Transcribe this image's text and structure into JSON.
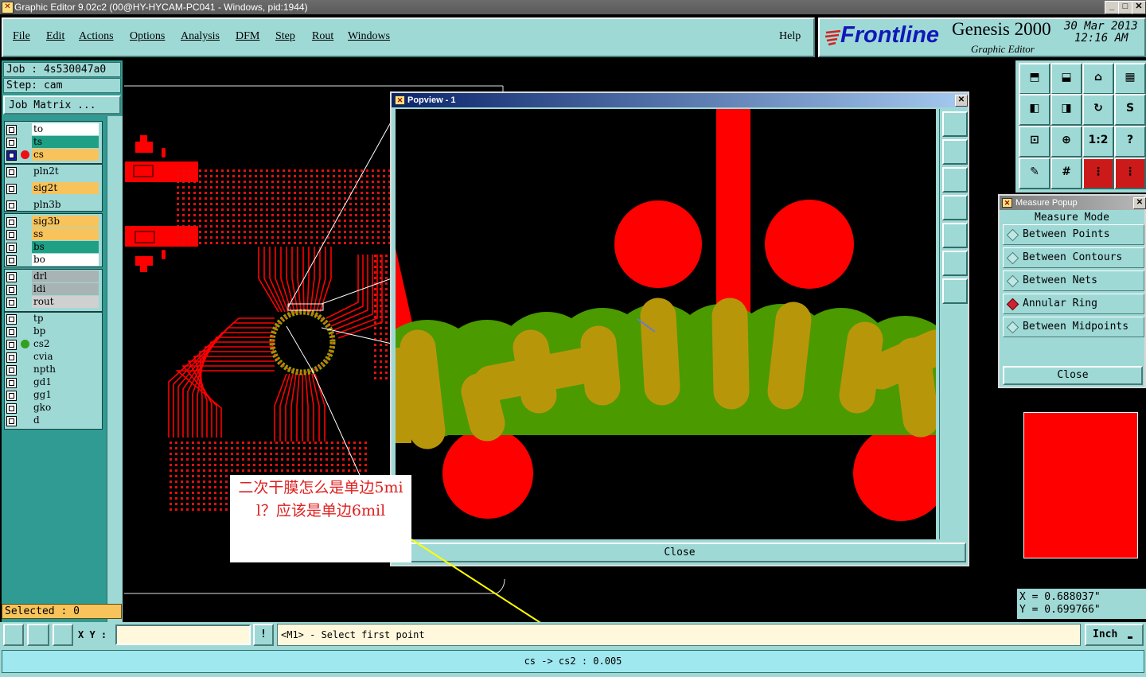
{
  "window": {
    "title": "Graphic Editor 9.02c2 (00@HY-HYCAM-PC041 - Windows, pid:1944)"
  },
  "menu": [
    "File",
    "Edit",
    "Actions",
    "Options",
    "Analysis",
    "DFM",
    "Step",
    "Rout",
    "Windows"
  ],
  "help_label": "Help",
  "brand": {
    "logo": "Frontline",
    "product": "Genesis 2000",
    "subtitle": "Graphic Editor",
    "date": "30 Mar 2013",
    "time": "12:16 AM"
  },
  "job": {
    "job": "Job : 4s530047a0",
    "step": "Step: cam",
    "matrix_button": "Job Matrix ..."
  },
  "layers": [
    {
      "name": "to",
      "color": "#ffffff"
    },
    {
      "name": "ts",
      "color": "#1f9f84"
    },
    {
      "name": "cs",
      "color": "#f8c35a"
    },
    {
      "name": "pln2t",
      "color": "#9fd9d6"
    },
    {
      "name": "sig2t",
      "color": "#f8c35a"
    },
    {
      "name": "pln3b",
      "color": "#9fd9d6"
    },
    {
      "name": "sig3b",
      "color": "#f8c35a"
    },
    {
      "name": "ss",
      "color": "#f8c35a"
    },
    {
      "name": "bs",
      "color": "#1f9f84"
    },
    {
      "name": "bo",
      "color": "#ffffff"
    },
    {
      "name": "drl",
      "color": "#a8b4b4"
    },
    {
      "name": "ldi",
      "color": "#a8b4b4"
    },
    {
      "name": "rout",
      "color": "#d0d0d0"
    },
    {
      "name": "tp",
      "color": "#9fd9d6"
    },
    {
      "name": "bp",
      "color": "#9fd9d6"
    },
    {
      "name": "cs2",
      "color": "#9fd9d6"
    },
    {
      "name": "cvia",
      "color": "#9fd9d6"
    },
    {
      "name": "npth",
      "color": "#9fd9d6"
    },
    {
      "name": "gd1",
      "color": "#9fd9d6"
    },
    {
      "name": "gg1",
      "color": "#9fd9d6"
    },
    {
      "name": "gko",
      "color": "#9fd9d6"
    },
    {
      "name": "d",
      "color": "#9fd9d6"
    }
  ],
  "selected": "Selected : 0",
  "popview": {
    "title": "Popview - 1",
    "close_label": "Close"
  },
  "measure": {
    "title": "Measure Popup",
    "header": "Measure Mode",
    "options": [
      "Between Points",
      "Between Contours",
      "Between Nets",
      "Annular Ring",
      "Between Midpoints"
    ],
    "selected_index": 3,
    "close_label": "Close"
  },
  "coords": {
    "x": "X = 0.688037\"",
    "y": "Y = 0.699766\""
  },
  "annotation": "二次干膜怎么是单边5mil？应该是单边6mil",
  "statusbar": {
    "xy_label": "X Y :",
    "xy_value": "",
    "prompt": "<M1> - Select first point",
    "unit": "Inch",
    "result": "cs -> cs2 : 0.005"
  },
  "colors": {
    "panel": "#9fd9d6",
    "red": "#ff0000",
    "green": "#4a9a00",
    "overlap": "#b8960a"
  }
}
